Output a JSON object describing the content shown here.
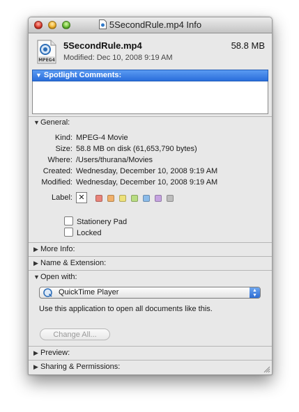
{
  "window": {
    "title": "5SecondRule.mp4 Info"
  },
  "header": {
    "file_name": "5SecondRule.mp4",
    "file_size": "58.8 MB",
    "modified": "Modified: Dec 10, 2008 9:19 AM",
    "icon_caption": "MPEG4"
  },
  "spotlight": {
    "label": "Spotlight Comments:",
    "value": ""
  },
  "general": {
    "label": "General:",
    "rows": [
      {
        "key": "Kind:",
        "value": "MPEG-4 Movie"
      },
      {
        "key": "Size:",
        "value": "58.8 MB on disk (61,653,790 bytes)"
      },
      {
        "key": "Where:",
        "value": "/Users/thurana/Movies"
      },
      {
        "key": "Created:",
        "value": "Wednesday, December 10, 2008 9:19 AM"
      },
      {
        "key": "Modified:",
        "value": "Wednesday, December 10, 2008 9:19 AM"
      }
    ],
    "label_key": "Label:",
    "label_clear": "✕",
    "label_colors": [
      "#e9837a",
      "#f0b06a",
      "#ede17a",
      "#b9dd82",
      "#8bbbe9",
      "#c5a3e0",
      "#bdbdbd"
    ],
    "stationery_pad": "Stationery Pad",
    "locked": "Locked"
  },
  "more_info": {
    "label": "More Info:"
  },
  "name_extension": {
    "label": "Name & Extension:"
  },
  "open_with": {
    "label": "Open with:",
    "app": "QuickTime Player",
    "description": "Use this application to open all documents like this.",
    "change_all": "Change All..."
  },
  "preview": {
    "label": "Preview:"
  },
  "sharing": {
    "label": "Sharing & Permissions:"
  }
}
